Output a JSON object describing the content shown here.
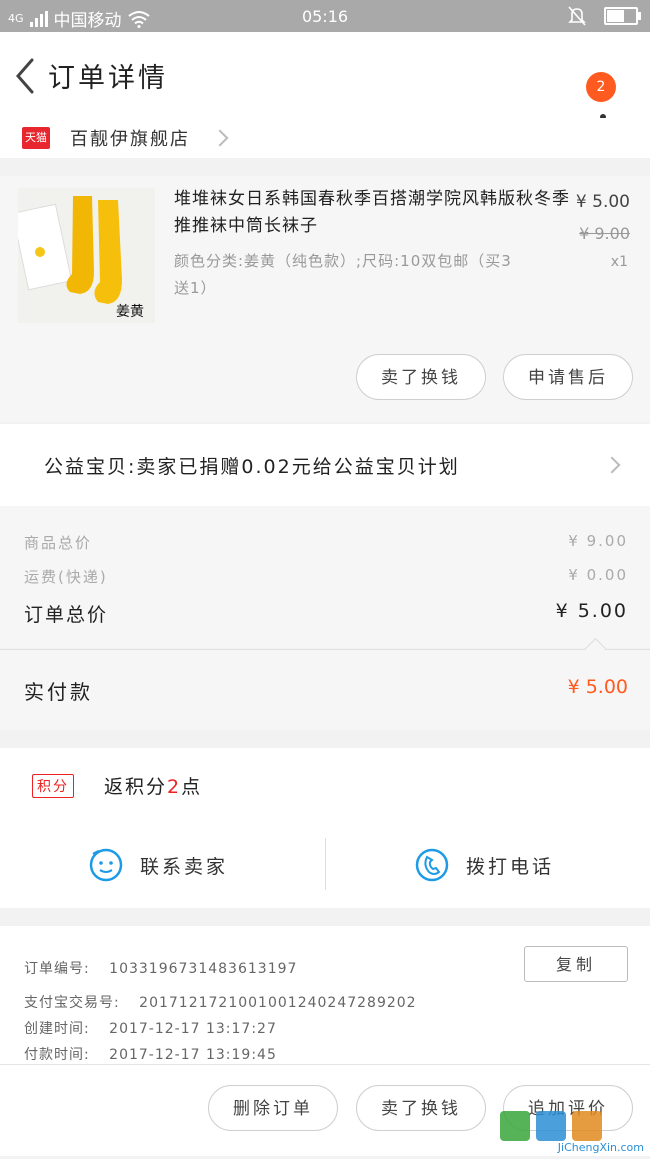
{
  "status_bar": {
    "network": "4G",
    "carrier": "中国移动",
    "time": "05:16"
  },
  "header": {
    "title": "订单详情",
    "badge_count": "2"
  },
  "shop": {
    "platform_tag": "天猫",
    "name": "百靓伊旗舰店"
  },
  "product": {
    "image_label": "姜黄",
    "name": "堆堆袜女日系韩国春秋季百搭潮学院风韩版秋冬季推推袜中筒长袜子",
    "spec": "颜色分类:姜黄（纯色款）;尺码:10双包邮（买3送1）",
    "price": "¥ 5.00",
    "original_price": "¥ 9.00",
    "quantity": "x1",
    "buttons": [
      "卖了换钱",
      "申请售后"
    ]
  },
  "charity": {
    "text": "公益宝贝:卖家已捐赠0.02元给公益宝贝计划"
  },
  "summary": {
    "goods_total_label": "商品总价",
    "goods_total": "¥ 9.00",
    "shipping_label": "运费(快递)",
    "shipping": "¥ 0.00",
    "order_total_label": "订单总价",
    "order_total": "¥ 5.00"
  },
  "paid": {
    "label": "实付款",
    "amount": "¥ 5.00"
  },
  "points": {
    "tag": "积分",
    "prefix": "返积分",
    "value": "2",
    "suffix": "点"
  },
  "contact": {
    "seller": "联系卖家",
    "call": "拨打电话"
  },
  "order_info": {
    "order_no_label": "订单编号:",
    "order_no": "1033196731483613197",
    "alipay_label": "支付宝交易号:",
    "alipay_no": "2017121721001001240247289202",
    "created_label": "创建时间:",
    "created": "2017-12-17 13:17:27",
    "paid_label": "付款时间:",
    "paid_time": "2017-12-17 13:19:45",
    "copy_button": "复制"
  },
  "bottom_actions": [
    "删除订单",
    "卖了换钱",
    "追加评价"
  ],
  "watermark": {
    "site": "JiChengXin.com"
  },
  "colors": {
    "accent": "#ff5a1f",
    "tmall_red": "#e8262e",
    "contact_blue": "#1e9be6",
    "status_bar": "#a9a9a9"
  }
}
